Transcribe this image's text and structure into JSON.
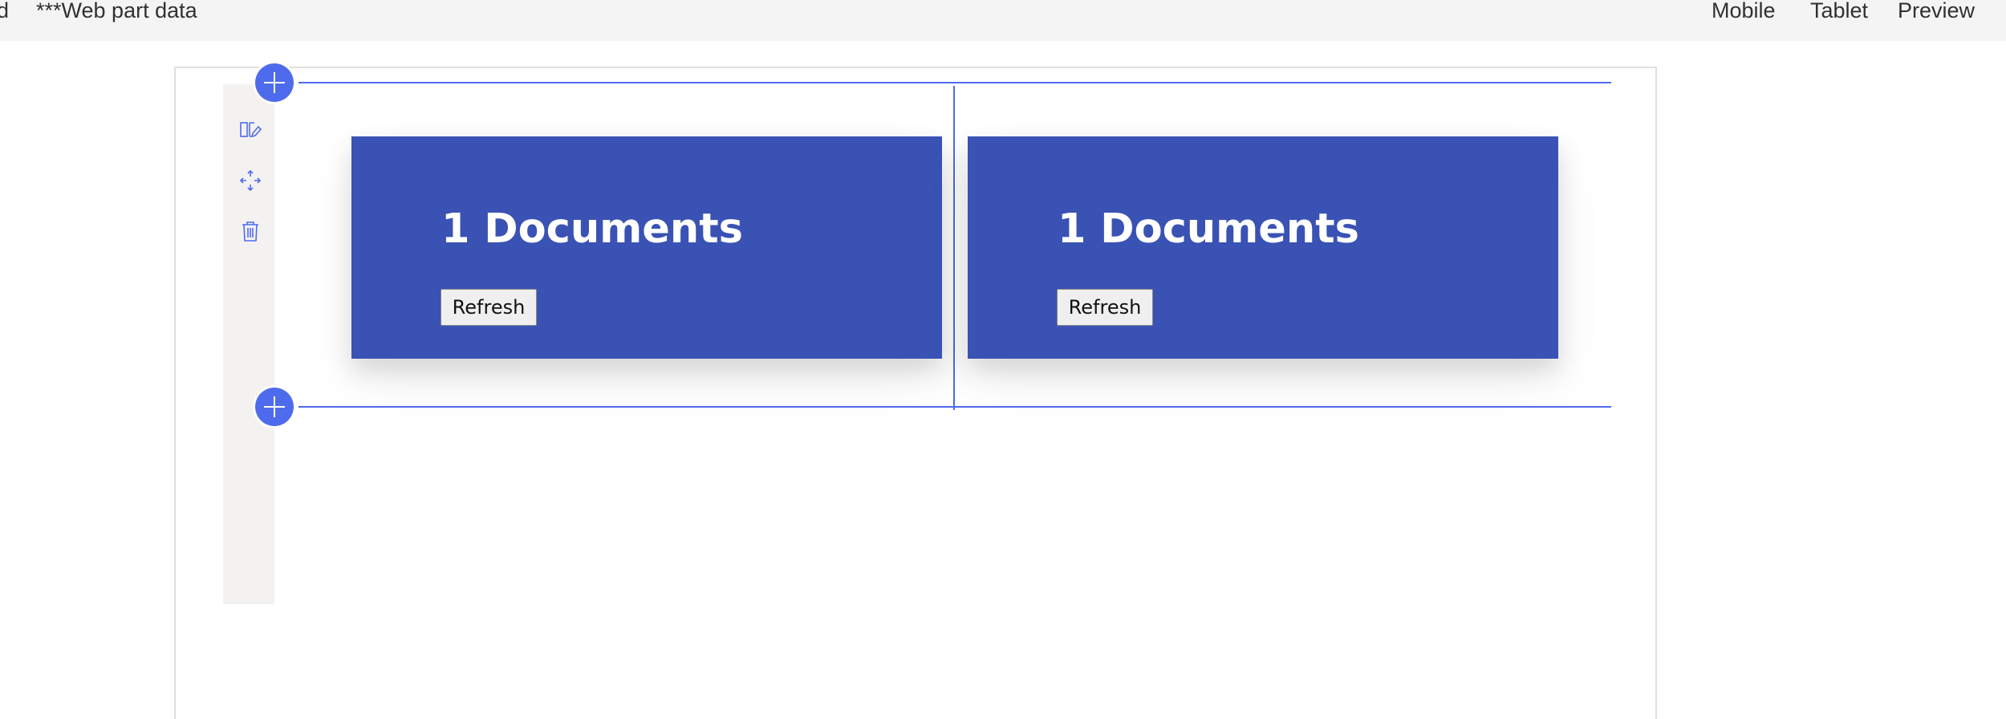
{
  "toolbar": {
    "left_stub": "d",
    "web_part_data": "***Web part data",
    "mobile": "Mobile",
    "tablet": "Tablet",
    "preview": "Preview"
  },
  "section_toolbar": {
    "icons": [
      "edit-section-icon",
      "move-section-icon",
      "delete-section-icon"
    ]
  },
  "web_parts": [
    {
      "title": "1 Documents",
      "button_label": "Refresh"
    },
    {
      "title": "1 Documents",
      "button_label": "Refresh"
    }
  ],
  "colors": {
    "accent": "#4f6bed",
    "card_background": "#3a52b4",
    "toolbar_background": "#f4f4f4",
    "section_toolbar_background": "#f3f2f1"
  }
}
